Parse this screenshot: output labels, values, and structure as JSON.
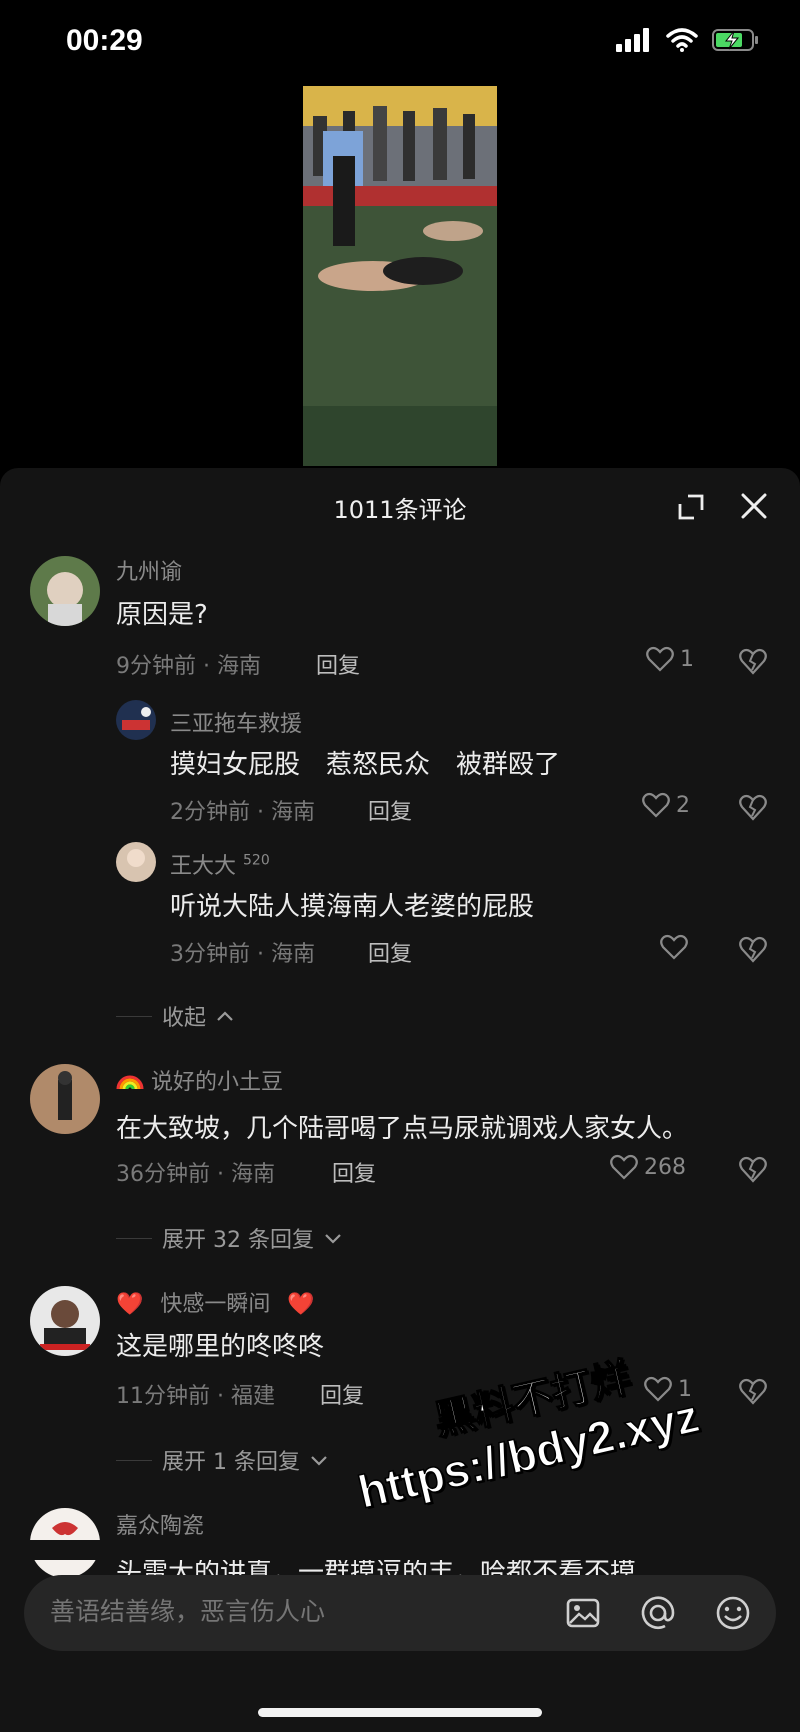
{
  "status_bar": {
    "time": "00:29"
  },
  "panel": {
    "comment_count": "1011条评论"
  },
  "comments": [
    {
      "username": "九州谕",
      "content": "原因是?",
      "time_location": "9分钟前 · 海南",
      "reply": "回复",
      "likes": "1"
    },
    {
      "username": "三亚拖车救援",
      "content": "摸妇女屁股　惹怒民众　被群殴了",
      "time_location": "2分钟前 · 海南",
      "reply": "回复",
      "likes": "2"
    },
    {
      "username": "王大大",
      "username_badge": "520",
      "content": "听说大陆人摸海南人老婆的屁股",
      "time_location": "3分钟前 · 海南",
      "reply": "回复",
      "likes": ""
    },
    {
      "username": "说好的小土豆",
      "content": "在大致坡，几个陆哥喝了点马尿就调戏人家女人。",
      "time_location": "36分钟前 · 海南",
      "reply": "回复",
      "likes": "268"
    },
    {
      "username": "快感一瞬间",
      "content": "这是哪里的咚咚咚",
      "time_location": "11分钟前 · 福建",
      "reply": "回复",
      "likes": "1"
    },
    {
      "username": "嘉众陶瓷",
      "content": "头雷大的讲真，一群摸逗的丰，哈都不看不摸"
    }
  ],
  "toggles": {
    "collapse": "收起",
    "expand_32": "展开 32 条回复",
    "expand_1": "展开 1 条回复"
  },
  "input": {
    "placeholder": "善语结善缘，恶言伤人心"
  },
  "watermark": {
    "line1": "黑料不打烊",
    "line2": "https://bdy2.xyz"
  },
  "colors": {
    "panel_bg": "#141414",
    "heart": "#e02020"
  }
}
